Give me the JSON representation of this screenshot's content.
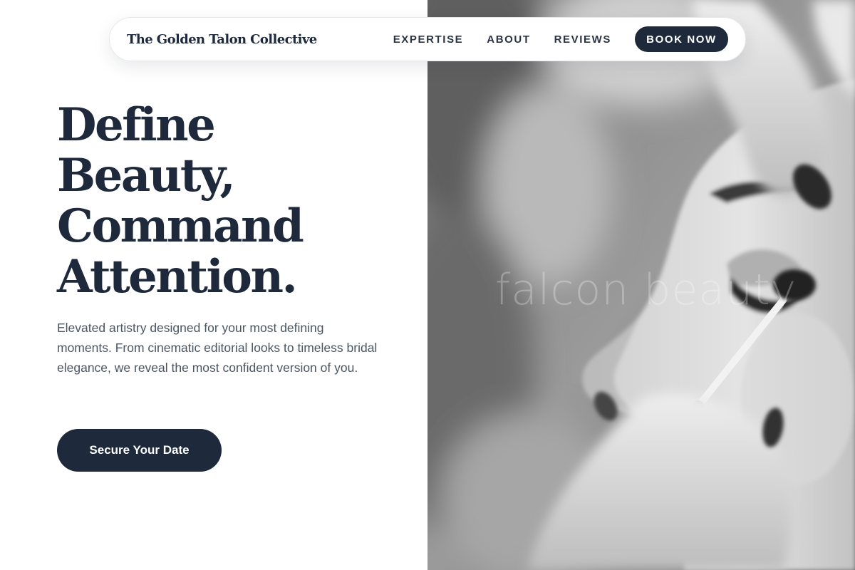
{
  "header": {
    "brand": "The Golden Talon Collective",
    "nav": [
      "EXPERTISE",
      "ABOUT",
      "REVIEWS"
    ],
    "cta_label": "BOOK NOW"
  },
  "hero": {
    "title_lines": [
      "Define",
      "Beauty,",
      "Command",
      "Attention."
    ],
    "description": "Elevated artistry designed for your most defining moments. From cinematic editorial looks to timeless bridal elegance, we reveal the most confident version of you.",
    "cta_label": "Secure Your Date"
  },
  "photo": {
    "watermark": "falcon beauty",
    "icon": "makeup-application-photo"
  },
  "colors": {
    "primary": "#1e293b",
    "body_text": "#4b5563",
    "background": "#ffffff"
  }
}
